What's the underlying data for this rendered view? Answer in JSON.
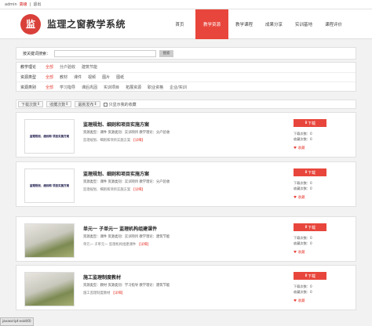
{
  "topbar": {
    "user": "admin",
    "level": "高级",
    "logout": "退出"
  },
  "header": {
    "logo_text": "监",
    "site_name": "监理之窗教学系统"
  },
  "nav": [
    {
      "label": "首页"
    },
    {
      "label": "教学资源",
      "active": true
    },
    {
      "label": "教学课程"
    },
    {
      "label": "成果分享"
    },
    {
      "label": "实训基地"
    },
    {
      "label": "课程评价"
    }
  ],
  "search": {
    "label": "按关键词搜索：",
    "placeholder": "",
    "button": "搜索"
  },
  "filters": [
    {
      "label": "教学理论",
      "options": [
        "全部",
        "分户验收",
        "建筑节能"
      ],
      "selected": 0
    },
    {
      "label": "资源类型",
      "options": [
        "全部",
        "教材",
        "课件",
        "视频",
        "图片",
        "图纸"
      ],
      "selected": 0
    },
    {
      "label": "资源类别",
      "options": [
        "全部",
        "学习指导",
        "课后巩固",
        "实训项目",
        "拓展资源",
        "职业资格",
        "企业/实训"
      ],
      "selected": 0
    }
  ],
  "sort": {
    "items": [
      "下载次数",
      "收藏次数",
      "最新发布"
    ],
    "only_label": "只显示我的收藏"
  },
  "items": [
    {
      "title": "监理规划、细则和项目实施方案",
      "meta": "资源类型：课件  资源类别：实训项目  教学理论：分户验收",
      "author": "监理规划、细则和项目实施方案",
      "detail": "【详细】",
      "thumb": "监理规划、细则和\n项目实施方案",
      "img": false,
      "download": "下载",
      "downloads": "下载次数：0",
      "favs": "收藏次数：0",
      "fav": "收藏"
    },
    {
      "title": "监理规划、细则和项目实施方案",
      "meta": "资源类型：课件  资源类别：实训项目  教学理论：分户验收",
      "author": "监理规划、细则和项目实施方案",
      "detail": "【详细】",
      "thumb": "监理规划、细则和\n项目实施方案",
      "img": false,
      "download": "下载",
      "downloads": "下载次数：0",
      "favs": "收藏次数：0",
      "fav": "收藏"
    },
    {
      "title": "单元一  子单元一 监理机构组建课件",
      "meta": "资源类型：课件  资源类别：实训项目  教学理论：建筑节能",
      "author": "单元一 子单元一 监理机构组建课件",
      "detail": "【详细】",
      "thumb": "",
      "img": true,
      "download": "下载",
      "downloads": "下载次数：0",
      "favs": "收藏次数：0",
      "fav": "收藏"
    },
    {
      "title": "施工监理制度教材",
      "meta": "资源类型：教材  资源类别：学习指导  教学理论：建筑节能",
      "author": "施工监理制度教材",
      "detail": "【详细】",
      "thumb": "",
      "img": true,
      "download": "下载",
      "downloads": "下载次数：0",
      "favs": "收藏次数：0",
      "fav": "收藏"
    }
  ],
  "status": "javascript:void(0)"
}
